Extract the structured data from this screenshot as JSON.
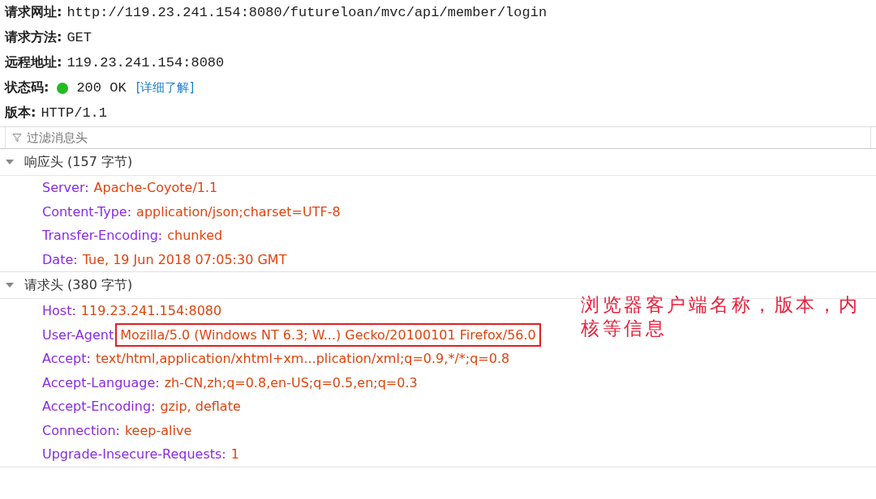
{
  "summary": [
    {
      "label": "请求网址:",
      "value": "http://119.23.241.154:8080/futureloan/mvc/api/member/login"
    },
    {
      "label": "请求方法:",
      "value": "GET"
    },
    {
      "label": "远程地址:",
      "value": "119.23.241.154:8080"
    },
    {
      "label": "状态码:",
      "value": "200 OK",
      "color": "#22bb22",
      "link": "[详细了解]"
    },
    {
      "label": "版本:",
      "value": "HTTP/1.1"
    }
  ],
  "filter": {
    "placeholder": "过滤消息头"
  },
  "sections": [
    {
      "title": "响应头 (157 字节)",
      "expanded": true,
      "headers": [
        {
          "name": "Server:",
          "value": "Apache-Coyote/1.1",
          "highlighted": false
        },
        {
          "name": "Content-Type:",
          "value": "application/json;charset=UTF-8",
          "highlighted": false
        },
        {
          "name": "Transfer-Encoding:",
          "value": "chunked",
          "highlighted": false
        },
        {
          "name": "Date:",
          "value": "Tue, 19 Jun 2018 07:05:30 GMT",
          "highlighted": false
        }
      ]
    },
    {
      "title": "请求头 (380 字节)",
      "expanded": true,
      "headers": [
        {
          "name": "Host:",
          "value": "119.23.241.154:8080",
          "highlighted": false
        },
        {
          "name": "User-Agent",
          "value": "Mozilla/5.0 (Windows NT 6.3; W...) Gecko/20100101 Firefox/56.0",
          "highlighted": true
        },
        {
          "name": "Accept:",
          "value": "text/html,application/xhtml+xm...plication/xml;q=0.9,*/*;q=0.8",
          "highlighted": false
        },
        {
          "name": "Accept-Language:",
          "value": "zh-CN,zh;q=0.8,en-US;q=0.5,en;q=0.3",
          "highlighted": false
        },
        {
          "name": "Accept-Encoding:",
          "value": "gzip, deflate",
          "highlighted": false
        },
        {
          "name": "Connection:",
          "value": "keep-alive",
          "highlighted": false
        },
        {
          "name": "Upgrade-Insecure-Requests:",
          "value": "1",
          "highlighted": false
        }
      ]
    }
  ],
  "annotation": "浏览器客户端名称，版本，内核等信息"
}
